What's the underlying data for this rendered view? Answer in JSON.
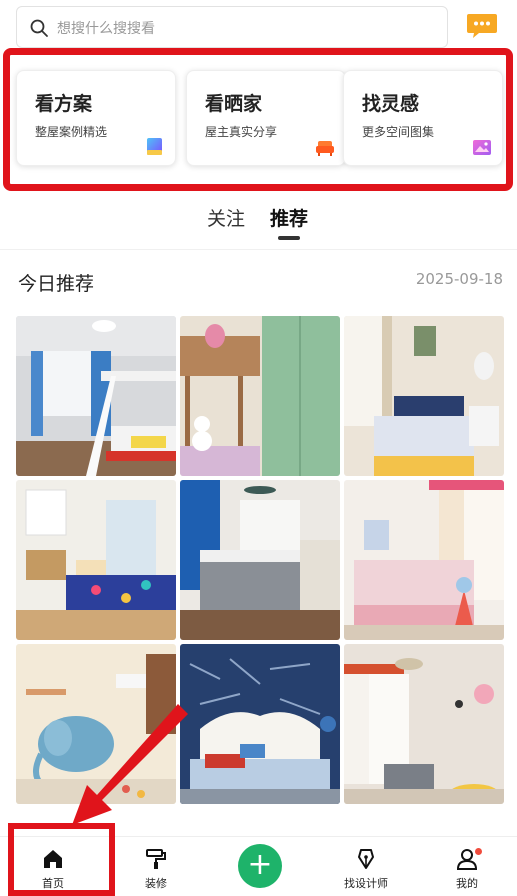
{
  "search": {
    "placeholder": "想搜什么搜搜看"
  },
  "icons": {
    "search": "search-icon",
    "messages": "message-icon"
  },
  "cards": [
    {
      "title": "看方案",
      "subtitle": "整屋案例精选",
      "icon": "gradient-cube-icon"
    },
    {
      "title": "看晒家",
      "subtitle": "屋主真实分享",
      "icon": "sofa-icon"
    },
    {
      "title": "找灵感",
      "subtitle": "更多空间图集",
      "icon": "picture-icon"
    }
  ],
  "tabs": [
    {
      "label": "关注"
    },
    {
      "label": "推荐"
    }
  ],
  "feed": {
    "title": "今日推荐",
    "date": "2025-09-18"
  },
  "bottom_nav": [
    {
      "label": "首页",
      "icon": "home-icon"
    },
    {
      "label": "装修",
      "icon": "paint-roller-icon"
    },
    {
      "label": "",
      "icon": "plus-icon"
    },
    {
      "label": "找设计师",
      "icon": "pen-nib-icon"
    },
    {
      "label": "我的",
      "icon": "user-icon"
    }
  ],
  "colors": {
    "accent_green": "#1eb36a",
    "highlight_red": "#e0141b"
  }
}
